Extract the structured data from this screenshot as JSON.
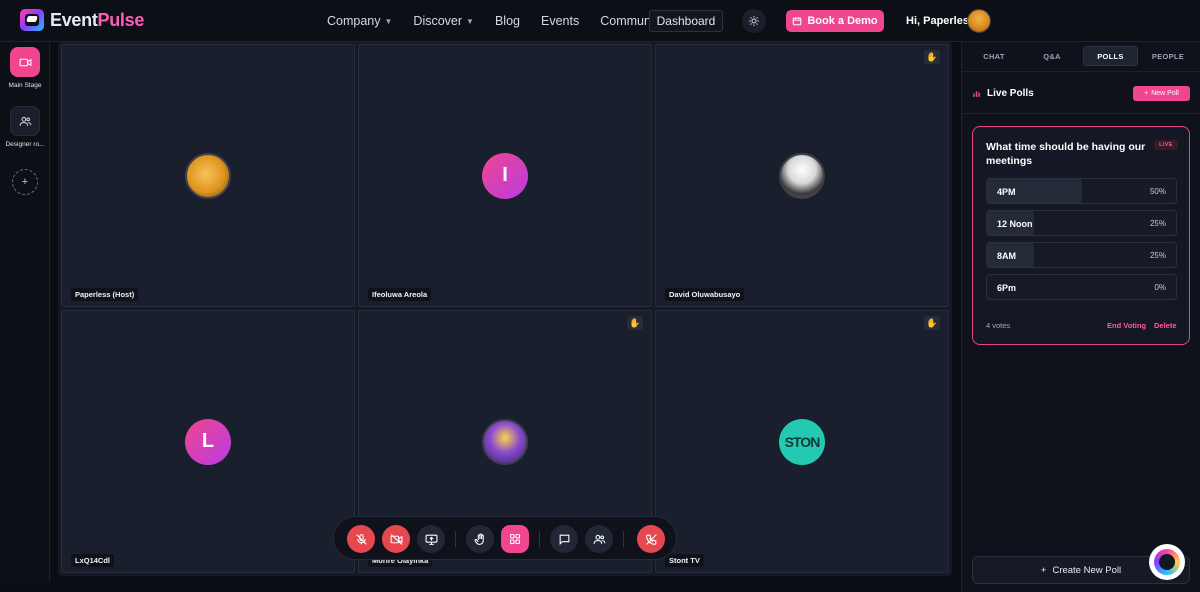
{
  "brand": {
    "name_a": "Event",
    "name_b": "Pulse"
  },
  "nav": {
    "company": "Company",
    "discover": "Discover",
    "blog": "Blog",
    "events": "Events",
    "community": "Community",
    "dashboard": "Dashboard",
    "book_demo": "Book a Demo",
    "greeting": "Hi, Paperless"
  },
  "rail": {
    "main_stage": "Main Stage",
    "designer_room": "Designer ro...",
    "add": "+"
  },
  "tiles": [
    {
      "name": "Paperless (Host)",
      "initial": ""
    },
    {
      "name": "Ifeoluwa Areola",
      "initial": "I"
    },
    {
      "name": "David Oluwabusayo",
      "initial": ""
    },
    {
      "name": "LxQ14Cdl",
      "initial": "L"
    },
    {
      "name": "Morire Olayinka",
      "initial": ""
    },
    {
      "name": "Stont TV",
      "initial": "STON"
    }
  ],
  "panel": {
    "tabs": [
      "CHAT",
      "Q&A",
      "POLLS",
      "PEOPLE"
    ],
    "live_polls": "Live Polls",
    "new_poll": "New Poll",
    "create_new_poll": "Create New Poll"
  },
  "poll": {
    "question": "What time should be having our meetings",
    "badge": "LIVE",
    "options": [
      {
        "label": "4PM",
        "pct": "50%",
        "share": 0.5
      },
      {
        "label": "12 Noon",
        "pct": "25%",
        "share": 0.25
      },
      {
        "label": "8AM",
        "pct": "25%",
        "share": 0.25
      },
      {
        "label": "6Pm",
        "pct": "0%",
        "share": 0
      }
    ],
    "votes": "4 votes",
    "end_voting": "End Voting",
    "delete": "Delete"
  },
  "colors": {
    "accent": "#f0458f",
    "danger": "#e6484f",
    "bg": "#0b0d14"
  }
}
